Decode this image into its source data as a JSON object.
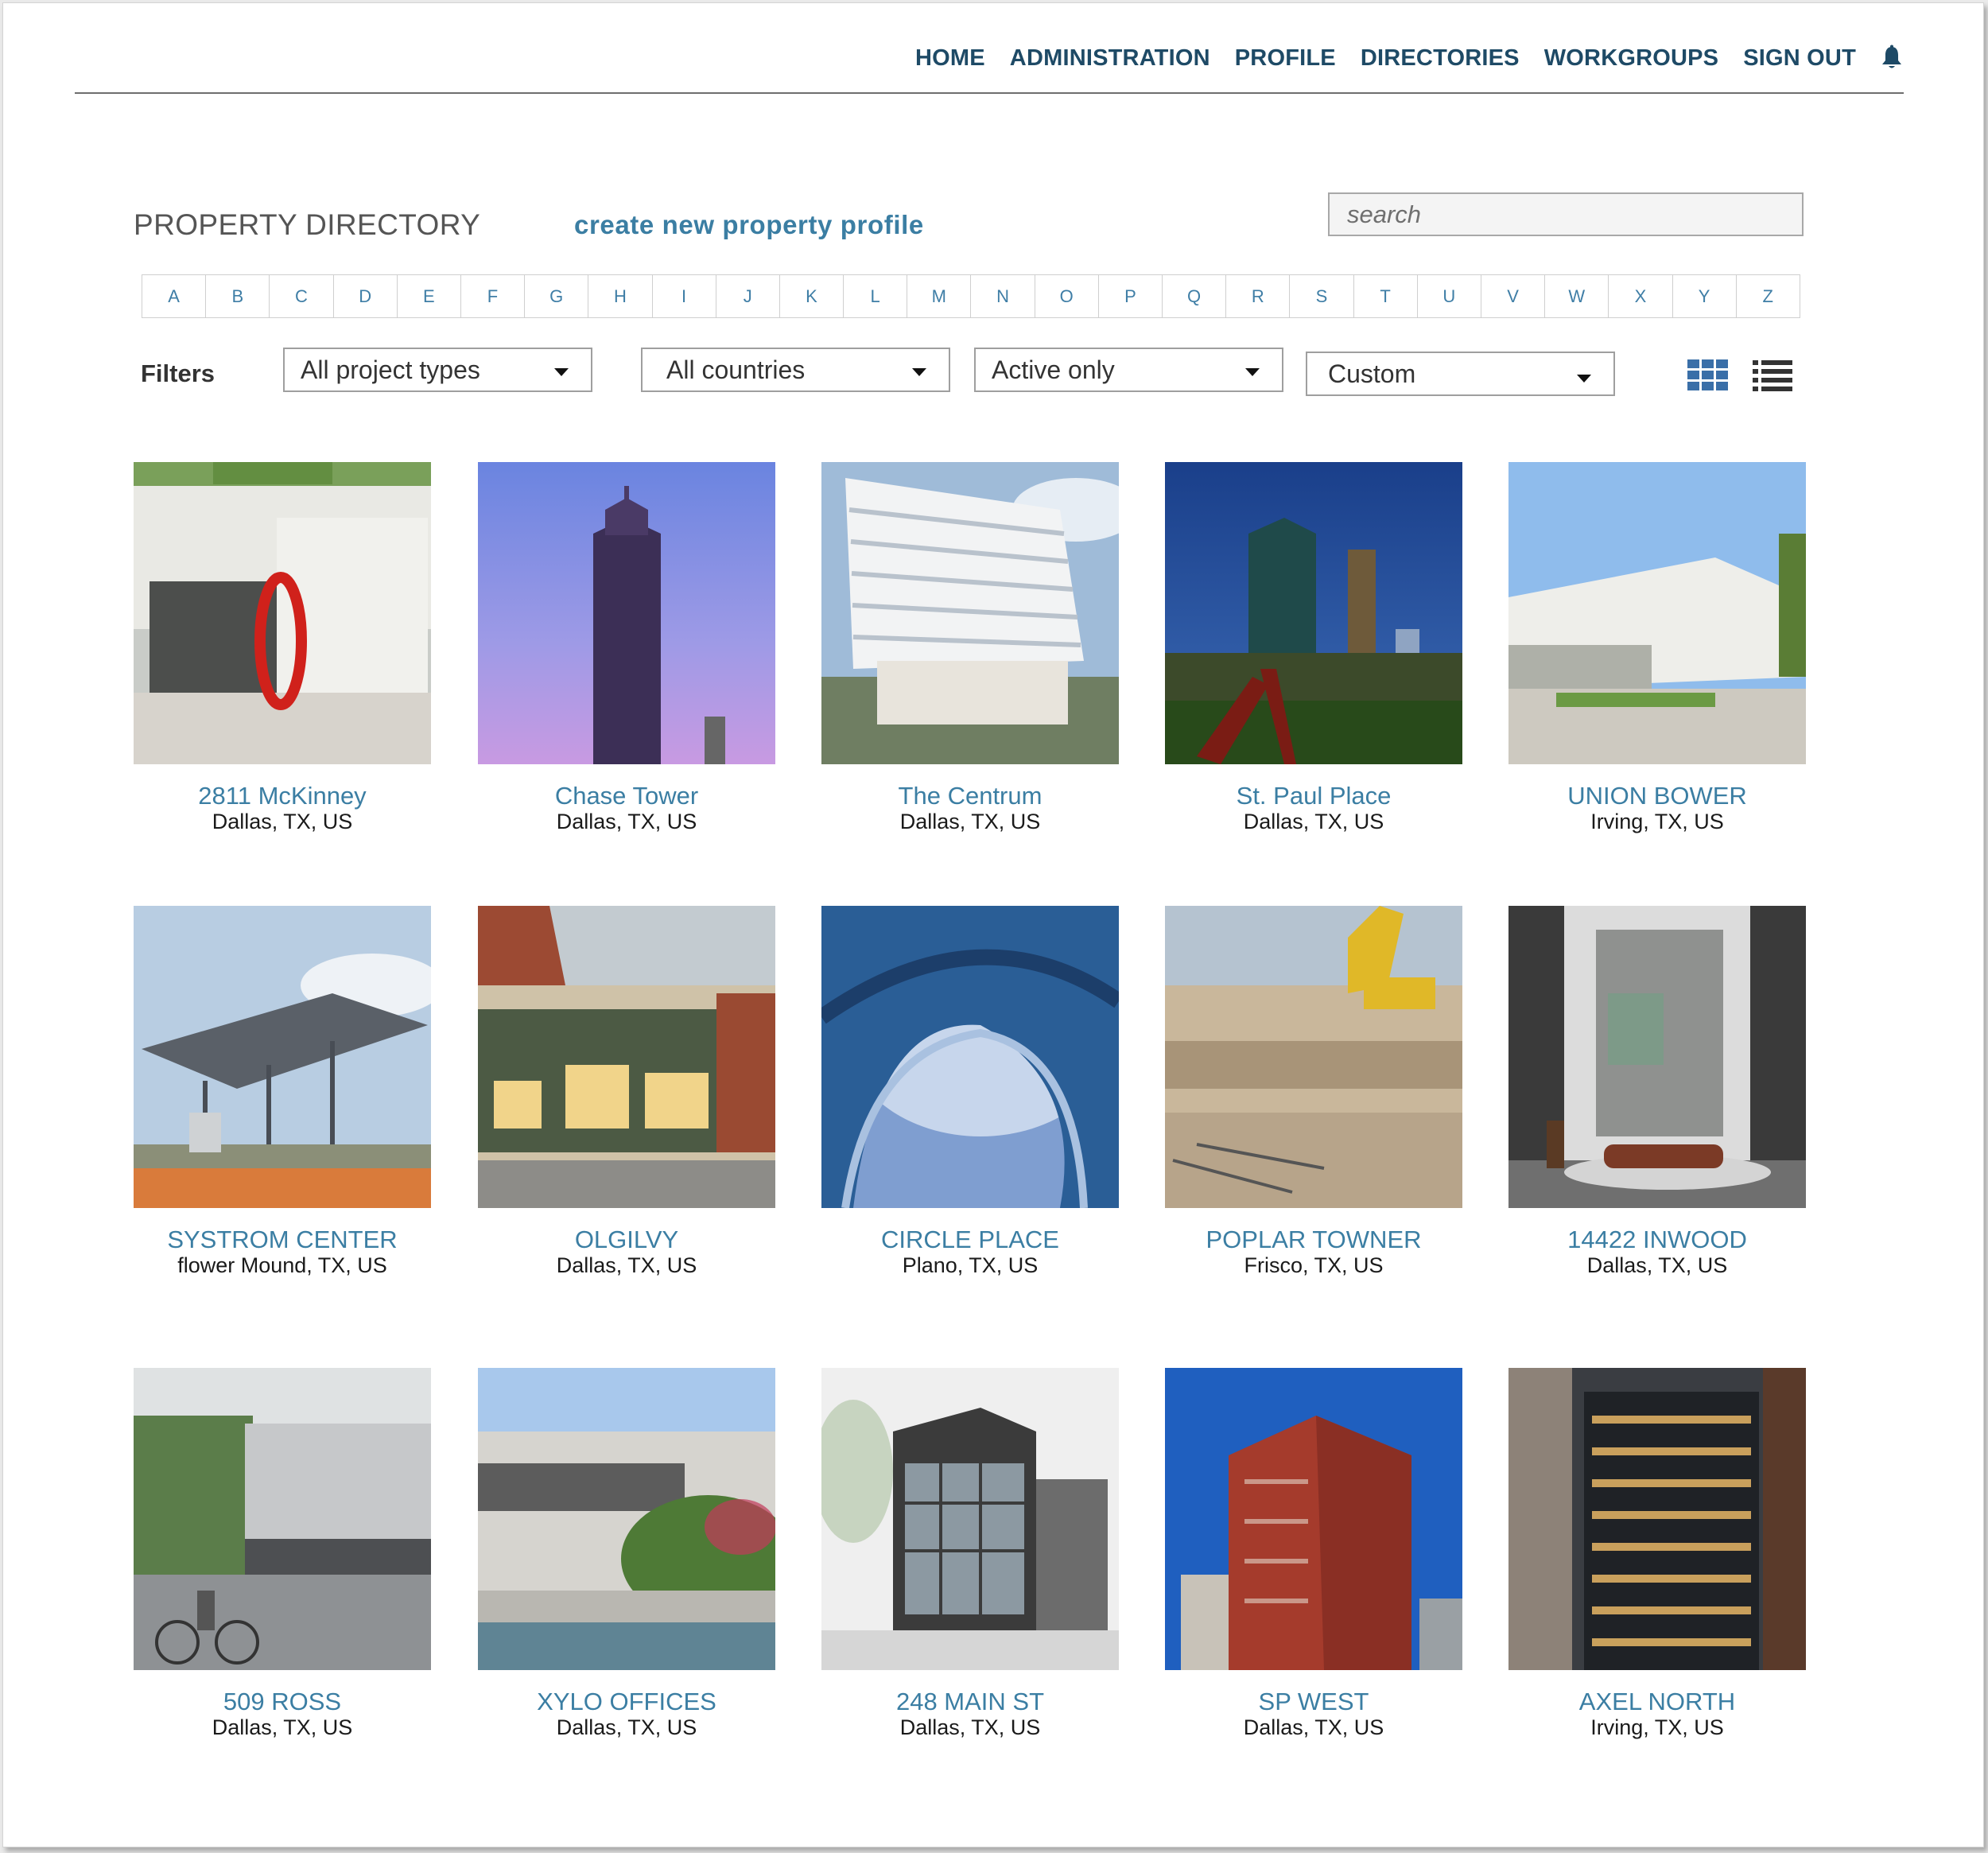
{
  "nav": {
    "items": [
      "HOME",
      "ADMINISTRATION",
      "PROFILE",
      "DIRECTORIES",
      "WORKGROUPS",
      "SIGN OUT"
    ],
    "bell_icon": "bell-icon"
  },
  "header": {
    "title": "PROPERTY DIRECTORY",
    "create_link": "create new property profile",
    "search_placeholder": "search"
  },
  "alphabet": [
    "A",
    "B",
    "C",
    "D",
    "E",
    "F",
    "G",
    "H",
    "I",
    "J",
    "K",
    "L",
    "M",
    "N",
    "O",
    "P",
    "Q",
    "R",
    "S",
    "T",
    "U",
    "V",
    "W",
    "X",
    "Y",
    "Z"
  ],
  "filters": {
    "label": "Filters",
    "project_type": "All project types",
    "country": "All countries",
    "status": "Active only",
    "custom": "Custom"
  },
  "view_toggle": {
    "grid_icon": "grid-view-icon",
    "list_icon": "list-view-icon",
    "active": "grid"
  },
  "properties": [
    {
      "name": "2811 McKinney",
      "location": "Dallas, TX, US"
    },
    {
      "name": "Chase Tower",
      "location": "Dallas, TX, US"
    },
    {
      "name": "The Centrum",
      "location": "Dallas, TX, US"
    },
    {
      "name": "St. Paul Place",
      "location": "Dallas, TX, US"
    },
    {
      "name": "UNION BOWER",
      "location": "Irving, TX, US"
    },
    {
      "name": "SYSTROM CENTER",
      "location": "flower Mound, TX, US"
    },
    {
      "name": "OLGILVY",
      "location": "Dallas, TX, US"
    },
    {
      "name": "CIRCLE PLACE",
      "location": "Plano, TX, US"
    },
    {
      "name": "POPLAR TOWNER",
      "location": "Frisco, TX, US"
    },
    {
      "name": "14422 INWOOD",
      "location": "Dallas, TX, US"
    },
    {
      "name": "509 ROSS",
      "location": "Dallas, TX, US"
    },
    {
      "name": "XYLO OFFICES",
      "location": "Dallas, TX, US"
    },
    {
      "name": "248 MAIN ST",
      "location": "Dallas, TX, US"
    },
    {
      "name": "SP WEST",
      "location": "Dallas, TX, US"
    },
    {
      "name": "AXEL NORTH",
      "location": "Irving, TX, US"
    }
  ],
  "colors": {
    "nav": "#1e4a66",
    "link": "#3b7ea3",
    "icon": "#3a6fa8"
  }
}
